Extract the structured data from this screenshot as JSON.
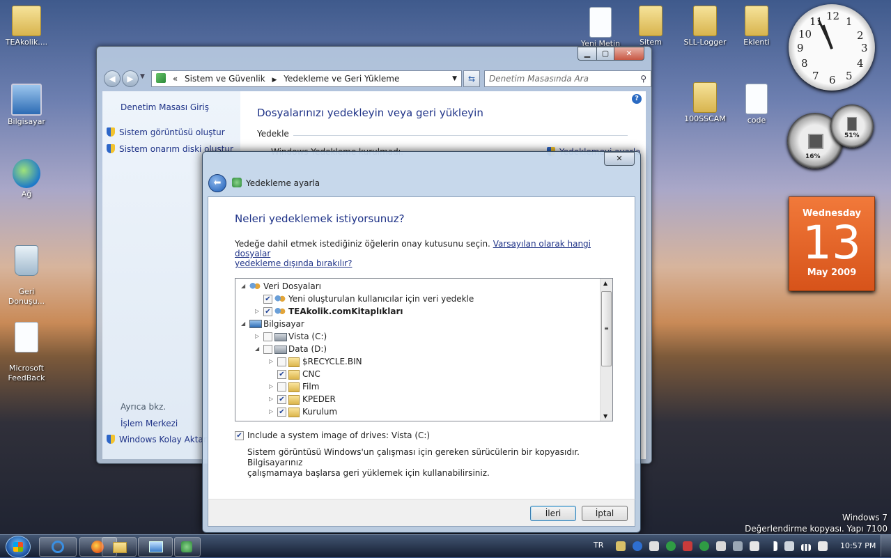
{
  "desktop": {
    "icons": [
      {
        "label": "TEAkolik...."
      },
      {
        "label": "Bilgisayar"
      },
      {
        "label": "Ağ"
      },
      {
        "label": "Geri\nDonuşu..."
      },
      {
        "label": "Microsoft\nFeedBack"
      },
      {
        "label": "Yeni Metin"
      },
      {
        "label": "Sitem"
      },
      {
        "label": "SLL-Logger"
      },
      {
        "label": "Eklenti"
      },
      {
        "label": "100SSCAM"
      },
      {
        "label": "code"
      }
    ],
    "watermark": {
      "line1": "Windows 7",
      "line2": "Değerlendirme kopyası. Yapı 7100"
    }
  },
  "gadgets": {
    "clock_numbers": [
      "12",
      "1",
      "2",
      "3",
      "4",
      "5",
      "6",
      "7",
      "8",
      "9",
      "10",
      "11"
    ],
    "cpu_percent": "16%",
    "mem_percent": "51%",
    "calendar": {
      "weekday": "Wednesday",
      "day": "13",
      "month_year": "May 2009"
    }
  },
  "control_panel": {
    "breadcrumb_prefix": "«",
    "breadcrumb": [
      "Sistem ve Güvenlik",
      "Yedekleme ve Geri Yükleme"
    ],
    "search_placeholder": "Denetim Masasında Ara",
    "left": {
      "home": "Denetim Masası Giriş",
      "items": [
        "Sistem görüntüsü oluştur",
        "Sistem onarım diski oluştur"
      ],
      "see_also_title": "Ayrıca bkz.",
      "see_also": [
        "İşlem Merkezi",
        "Windows Kolay Aktarım"
      ]
    },
    "main": {
      "title": "Dosyalarınızı yedekleyin veya geri yükleyin",
      "section": "Yedekle",
      "status": "Windows Yedekleme kurulmadı.",
      "setup_link": "Yedeklemeyi ayarla"
    }
  },
  "dialog": {
    "title": "Yedekleme ayarla",
    "close_label": "✕",
    "heading": "Neleri yedeklemek istiyorsunuz?",
    "instruction": "Yedeğe dahil etmek istediğiniz öğelerin onay kutusunu seçin.",
    "link_line1": "Varsayılan olarak hangi dosyalar",
    "link_line2": "yedekleme dışında bırakılır?",
    "tree": [
      {
        "label": "Veri Dosyaları",
        "level": 0,
        "expander": "◢",
        "checkbox": null,
        "icon": "users-icon",
        "bold": false
      },
      {
        "label": "Yeni oluşturulan kullanıcılar için veri yedekle",
        "level": 1,
        "expander": "",
        "checkbox": true,
        "icon": "users-icon",
        "bold": false
      },
      {
        "label": "TEAkolik.comKitaplıkları",
        "level": 1,
        "expander": "▷",
        "checkbox": true,
        "icon": "users-icon",
        "bold": true
      },
      {
        "label": "Bilgisayar",
        "level": 0,
        "expander": "◢",
        "checkbox": null,
        "icon": "computer-icon",
        "bold": false
      },
      {
        "label": "Vista (C:)",
        "level": 1,
        "expander": "▷",
        "checkbox": false,
        "icon": "drive-icon",
        "bold": false
      },
      {
        "label": "Data (D:)",
        "level": 1,
        "expander": "◢",
        "checkbox": false,
        "icon": "drive-icon",
        "bold": false
      },
      {
        "label": "$RECYCLE.BIN",
        "level": 2,
        "expander": "▷",
        "checkbox": false,
        "icon": "folder-icon",
        "bold": false
      },
      {
        "label": "CNC",
        "level": 2,
        "expander": "",
        "checkbox": true,
        "icon": "folder-icon",
        "bold": false
      },
      {
        "label": "Film",
        "level": 2,
        "expander": "▷",
        "checkbox": false,
        "icon": "folder-icon",
        "bold": false
      },
      {
        "label": "KPEDER",
        "level": 2,
        "expander": "▷",
        "checkbox": true,
        "icon": "folder-icon",
        "bold": false
      },
      {
        "label": "Kurulum",
        "level": 2,
        "expander": "▷",
        "checkbox": true,
        "icon": "folder-icon",
        "bold": false
      }
    ],
    "system_image_label": "Include a system image of drives: Vista (C:)",
    "system_image_checked": true,
    "description_line1": "Sistem görüntüsü Windows'un çalışması için gereken sürücülerin bir kopyasıdır. Bilgisayarınız",
    "description_line2": "çalışmamaya başlarsa geri yüklemek için kullanabilirsiniz.",
    "next_button": "İleri",
    "cancel_button": "İptal"
  },
  "taskbar": {
    "language": "TR",
    "time": "10:57 PM"
  }
}
